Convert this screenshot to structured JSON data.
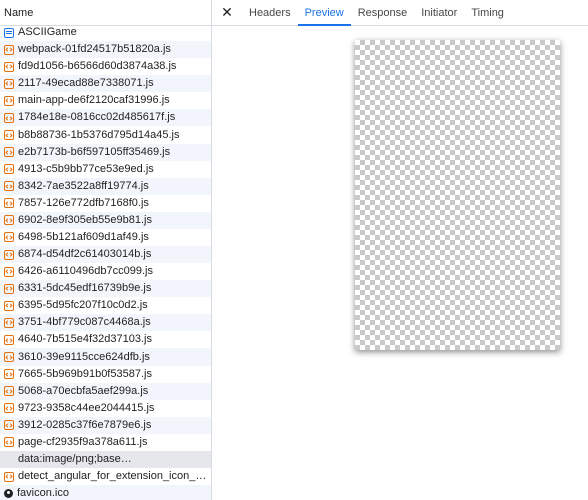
{
  "network": {
    "name_header": "Name",
    "requests": [
      {
        "label": "ASCIIGame",
        "icon": "document-icon",
        "type": "doc"
      },
      {
        "label": "webpack-01fd24517b51820a.js",
        "icon": "script-icon",
        "type": "js"
      },
      {
        "label": "fd9d1056-b6566d60d3874a38.js",
        "icon": "script-icon",
        "type": "js"
      },
      {
        "label": "2117-49ecad88e7338071.js",
        "icon": "script-icon",
        "type": "js"
      },
      {
        "label": "main-app-de6f2120caf31996.js",
        "icon": "script-icon",
        "type": "js"
      },
      {
        "label": "1784e18e-0816cc02d485617f.js",
        "icon": "script-icon",
        "type": "js"
      },
      {
        "label": "b8b88736-1b5376d795d14a45.js",
        "icon": "script-icon",
        "type": "js"
      },
      {
        "label": "e2b7173b-b6f597105ff35469.js",
        "icon": "script-icon",
        "type": "js"
      },
      {
        "label": "4913-c5b9bb77ce53e9ed.js",
        "icon": "script-icon",
        "type": "js"
      },
      {
        "label": "8342-7ae3522a8ff19774.js",
        "icon": "script-icon",
        "type": "js"
      },
      {
        "label": "7857-126e772dfb7168f0.js",
        "icon": "script-icon",
        "type": "js"
      },
      {
        "label": "6902-8e9f305eb55e9b81.js",
        "icon": "script-icon",
        "type": "js"
      },
      {
        "label": "6498-5b121af609d1af49.js",
        "icon": "script-icon",
        "type": "js"
      },
      {
        "label": "6874-d54df2c61403014b.js",
        "icon": "script-icon",
        "type": "js"
      },
      {
        "label": "6426-a6110496db7cc099.js",
        "icon": "script-icon",
        "type": "js"
      },
      {
        "label": "6331-5dc45edf16739b9e.js",
        "icon": "script-icon",
        "type": "js"
      },
      {
        "label": "6395-5d95fc207f10c0d2.js",
        "icon": "script-icon",
        "type": "js"
      },
      {
        "label": "3751-4bf779c087c4468a.js",
        "icon": "script-icon",
        "type": "js"
      },
      {
        "label": "4640-7b515e4f32d37103.js",
        "icon": "script-icon",
        "type": "js"
      },
      {
        "label": "3610-39e9115cce624dfb.js",
        "icon": "script-icon",
        "type": "js"
      },
      {
        "label": "7665-5b969b91b0f53587.js",
        "icon": "script-icon",
        "type": "js"
      },
      {
        "label": "5068-a70ecbfa5aef299a.js",
        "icon": "script-icon",
        "type": "js"
      },
      {
        "label": "9723-9358c44ee2044415.js",
        "icon": "script-icon",
        "type": "js"
      },
      {
        "label": "3912-0285c37f6e7879e6.js",
        "icon": "script-icon",
        "type": "js"
      },
      {
        "label": "page-cf2935f9a378a611.js",
        "icon": "script-icon",
        "type": "js"
      },
      {
        "label": "data:image/png;base…",
        "icon": "",
        "type": "none",
        "selected": true
      },
      {
        "label": "detect_angular_for_extension_icon_bund…",
        "icon": "script-icon",
        "type": "js"
      },
      {
        "label": "favicon.ico",
        "icon": "favicon-icon",
        "type": "favicon"
      }
    ]
  },
  "details": {
    "close_label": "✕",
    "tabs": [
      {
        "label": "Headers",
        "active": false
      },
      {
        "label": "Preview",
        "active": true
      },
      {
        "label": "Response",
        "active": false
      },
      {
        "label": "Initiator",
        "active": false
      },
      {
        "label": "Timing",
        "active": false
      }
    ]
  },
  "colors": {
    "accent": "#1a73e8",
    "script_icon": "#e8710a",
    "selected_row": "#e6e7ea",
    "alt_row": "#f2f6fc",
    "divider": "#d6dbe3"
  }
}
